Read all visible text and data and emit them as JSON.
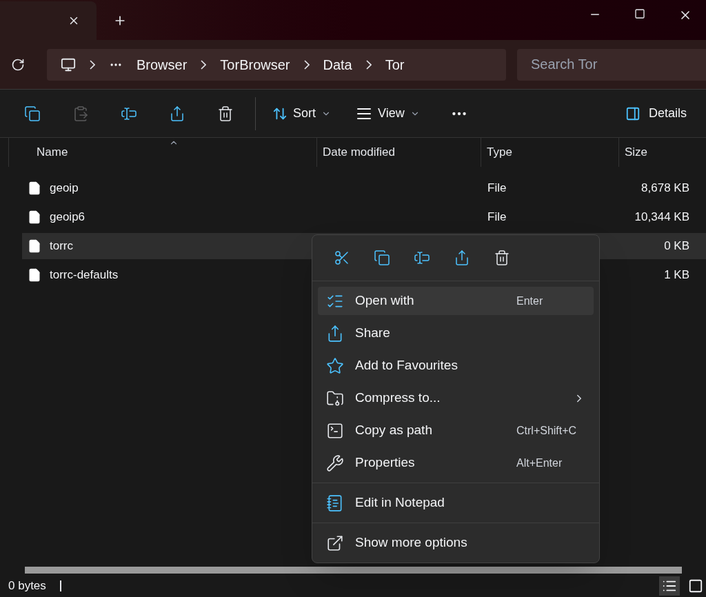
{
  "breadcrumbs": [
    "Browser",
    "TorBrowser",
    "Data",
    "Tor"
  ],
  "search": {
    "placeholder": "Search Tor"
  },
  "toolbar": {
    "actions": [
      {
        "kind": "copy",
        "disabled": false
      },
      {
        "kind": "paste",
        "disabled": true
      },
      {
        "kind": "rename",
        "disabled": false
      },
      {
        "kind": "share",
        "disabled": false
      },
      {
        "kind": "delete",
        "disabled": false
      }
    ],
    "sort": "Sort",
    "view": "View",
    "details": "Details"
  },
  "columns": [
    {
      "label": "Name",
      "sorted": true
    },
    {
      "label": "Date modified",
      "sorted": false
    },
    {
      "label": "Type",
      "sorted": false
    },
    {
      "label": "Size",
      "sorted": false
    }
  ],
  "files": [
    {
      "name": "geoip",
      "type": "File",
      "size": "8,678 KB",
      "selected": false
    },
    {
      "name": "geoip6",
      "type": "File",
      "size": "10,344 KB",
      "selected": false
    },
    {
      "name": "torrc",
      "size": "0 KB",
      "selected": true
    },
    {
      "name": "torrc-defaults",
      "size": "1 KB",
      "selected": false
    }
  ],
  "context_menu": {
    "quick_actions": [
      {
        "kind": "cut"
      },
      {
        "kind": "copy"
      },
      {
        "kind": "rename"
      },
      {
        "kind": "share"
      },
      {
        "kind": "delete"
      }
    ],
    "groups": [
      [
        {
          "kind": "open-with",
          "label": "Open with",
          "shortcut": "Enter",
          "selected": true,
          "submenu": false
        },
        {
          "kind": "share",
          "label": "Share",
          "selected": false,
          "submenu": false
        },
        {
          "kind": "star",
          "label": "Add to Favourites",
          "selected": false,
          "submenu": false
        },
        {
          "kind": "compress",
          "label": "Compress to...",
          "selected": false,
          "submenu": true
        },
        {
          "kind": "copy-path",
          "label": "Copy as path",
          "shortcut": "Ctrl+Shift+C",
          "selected": false,
          "submenu": false
        },
        {
          "kind": "properties",
          "label": "Properties",
          "shortcut": "Alt+Enter",
          "selected": false,
          "submenu": false
        }
      ],
      [
        {
          "kind": "notepad",
          "label": "Edit in Notepad",
          "selected": false,
          "submenu": false
        }
      ],
      [
        {
          "kind": "more",
          "label": "Show more options",
          "selected": false,
          "submenu": false
        }
      ]
    ]
  },
  "status_bar": {
    "text": "0 bytes",
    "views": [
      {
        "kind": "details",
        "selected": true
      },
      {
        "kind": "tiles",
        "selected": false
      }
    ]
  }
}
